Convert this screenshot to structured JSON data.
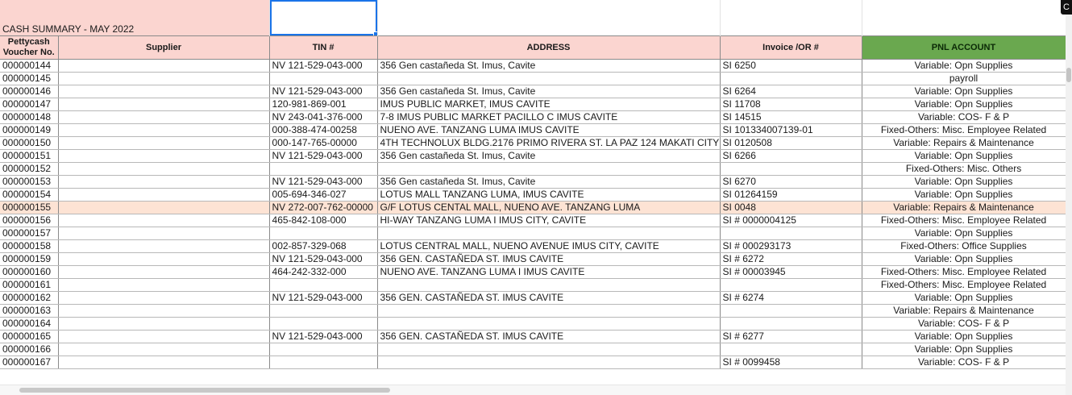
{
  "title": "CASH SUMMARY - MAY 2022",
  "headers": {
    "voucher": "Pettycash Voucher No.",
    "supplier": "Supplier",
    "tin": "TIN #",
    "address": "ADDRESS",
    "invoice": "Invoice /OR #",
    "pnl": "PNL ACCOUNT"
  },
  "rows": [
    {
      "voucher": "000000144",
      "supplier": "",
      "tin": "NV 121-529-043-000",
      "address": "356 Gen castañeda St. Imus, Cavite",
      "invoice": "SI 6250",
      "pnl": "Variable: Opn Supplies"
    },
    {
      "voucher": "000000145",
      "supplier": "",
      "tin": "",
      "address": "",
      "invoice": "",
      "pnl": "payroll"
    },
    {
      "voucher": "000000146",
      "supplier": "",
      "tin": "NV 121-529-043-000",
      "address": "356 Gen castañeda St. Imus, Cavite",
      "invoice": "SI 6264",
      "pnl": "Variable: Opn Supplies"
    },
    {
      "voucher": "000000147",
      "supplier": "",
      "tin": "120-981-869-001",
      "address": "IMUS PUBLIC MARKET, IMUS CAVITE",
      "invoice": "SI 11708",
      "pnl": "Variable: Opn Supplies"
    },
    {
      "voucher": "000000148",
      "supplier": "",
      "tin": "NV 243-041-376-000",
      "address": "7-8 IMUS PUBLIC MARKET PACILLO C IMUS CAVITE",
      "invoice": "SI 14515",
      "pnl": "Variable: COS- F & P"
    },
    {
      "voucher": "000000149",
      "supplier": "",
      "tin": "000-388-474-00258",
      "address": "NUENO AVE. TANZANG  LUMA IMUS CAVITE",
      "invoice": "SI 101334007139-01",
      "pnl": "Fixed-Others: Misc. Employee Related"
    },
    {
      "voucher": "000000150",
      "supplier": "",
      "tin": "000-147-765-00000",
      "address": "4TH TECHNOLUX BLDG.2176 PRIMO RIVERA ST. LA PAZ 124 MAKATI CITY",
      "invoice": "SI 0120508",
      "pnl": "Variable: Repairs & Maintenance"
    },
    {
      "voucher": "000000151",
      "supplier": "",
      "tin": "NV 121-529-043-000",
      "address": "356 Gen castañeda St. Imus, Cavite",
      "invoice": "SI 6266",
      "pnl": "Variable: Opn Supplies"
    },
    {
      "voucher": "000000152",
      "supplier": "",
      "tin": "",
      "address": "",
      "invoice": "",
      "pnl": "Fixed-Others: Misc. Others"
    },
    {
      "voucher": "000000153",
      "supplier": "",
      "tin": "NV 121-529-043-000",
      "address": "356 Gen castañeda St. Imus, Cavite",
      "invoice": "SI 6270",
      "pnl": "Variable: Opn Supplies"
    },
    {
      "voucher": "000000154",
      "supplier": "",
      "tin": "005-694-346-027",
      "address": "LOTUS MALL  TANZANG LUMA, IMUS CAVITE",
      "invoice": "SI 01264159",
      "pnl": "Variable: Opn Supplies"
    },
    {
      "voucher": "000000155",
      "supplier": "",
      "tin": "NV 272-007-762-00000",
      "address": "G/F LOTUS CENTAL MALL, NUENO AVE. TANZANG LUMA",
      "invoice": "SI 0048",
      "pnl": "Variable: Repairs & Maintenance",
      "highlight": true
    },
    {
      "voucher": "000000156",
      "supplier": "",
      "tin": "465-842-108-000",
      "address": "HI-WAY TANZANG LUMA I IMUS CITY, CAVITE",
      "invoice": "SI # 0000004125",
      "pnl": "Fixed-Others: Misc. Employee Related"
    },
    {
      "voucher": "000000157",
      "supplier": "",
      "tin": "",
      "address": "",
      "invoice": "",
      "pnl": "Variable: Opn Supplies"
    },
    {
      "voucher": "000000158",
      "supplier": "",
      "tin": "002-857-329-068",
      "address": "LOTUS CENTRAL MALL, NUENO AVENUE IMUS CITY, CAVITE",
      "invoice": "SI # 000293173",
      "pnl": "Fixed-Others: Office Supplies"
    },
    {
      "voucher": "000000159",
      "supplier": "",
      "tin": "NV 121-529-043-000",
      "address": "356 GEN. CASTAÑEDA ST. IMUS CAVITE",
      "invoice": "SI # 6272",
      "pnl": "Variable: Opn Supplies"
    },
    {
      "voucher": "000000160",
      "supplier": "",
      "tin": "464-242-332-000",
      "address": "NUENO AVE. TANZANG LUMA I IMUS CAVITE",
      "invoice": "SI # 00003945",
      "pnl": "Fixed-Others: Misc. Employee Related"
    },
    {
      "voucher": "000000161",
      "supplier": "",
      "tin": "",
      "address": "",
      "invoice": "",
      "pnl": "Fixed-Others: Misc. Employee Related"
    },
    {
      "voucher": "000000162",
      "supplier": "",
      "tin": "NV 121-529-043-000",
      "address": "356 GEN. CASTAÑEDA ST. IMUS CAVITE",
      "invoice": "SI # 6274",
      "pnl": "Variable: Opn Supplies"
    },
    {
      "voucher": "000000163",
      "supplier": "",
      "tin": "",
      "address": "",
      "invoice": "",
      "pnl": "Variable: Repairs & Maintenance"
    },
    {
      "voucher": "000000164",
      "supplier": "",
      "tin": "",
      "address": "",
      "invoice": "",
      "pnl": "Variable: COS- F & P"
    },
    {
      "voucher": "000000165",
      "supplier": "",
      "tin": "NV 121-529-043-000",
      "address": "356 GEN. CASTAÑEDA ST. IMUS CAVITE",
      "invoice": "SI # 6277",
      "pnl": "Variable: Opn Supplies"
    },
    {
      "voucher": "000000166",
      "supplier": "",
      "tin": "",
      "address": "",
      "invoice": "",
      "pnl": "Variable: Opn Supplies"
    },
    {
      "voucher": "000000167",
      "supplier": "",
      "tin": "",
      "address": "",
      "invoice": "SI # 0099458",
      "pnl": "Variable: COS- F & P"
    }
  ],
  "colors": {
    "header_bg": "#fbd5d0",
    "pnl_header_bg": "#6aa84f",
    "highlight_row": "#fde3d4",
    "selection": "#1a73e8"
  },
  "corner_button_label": "C"
}
